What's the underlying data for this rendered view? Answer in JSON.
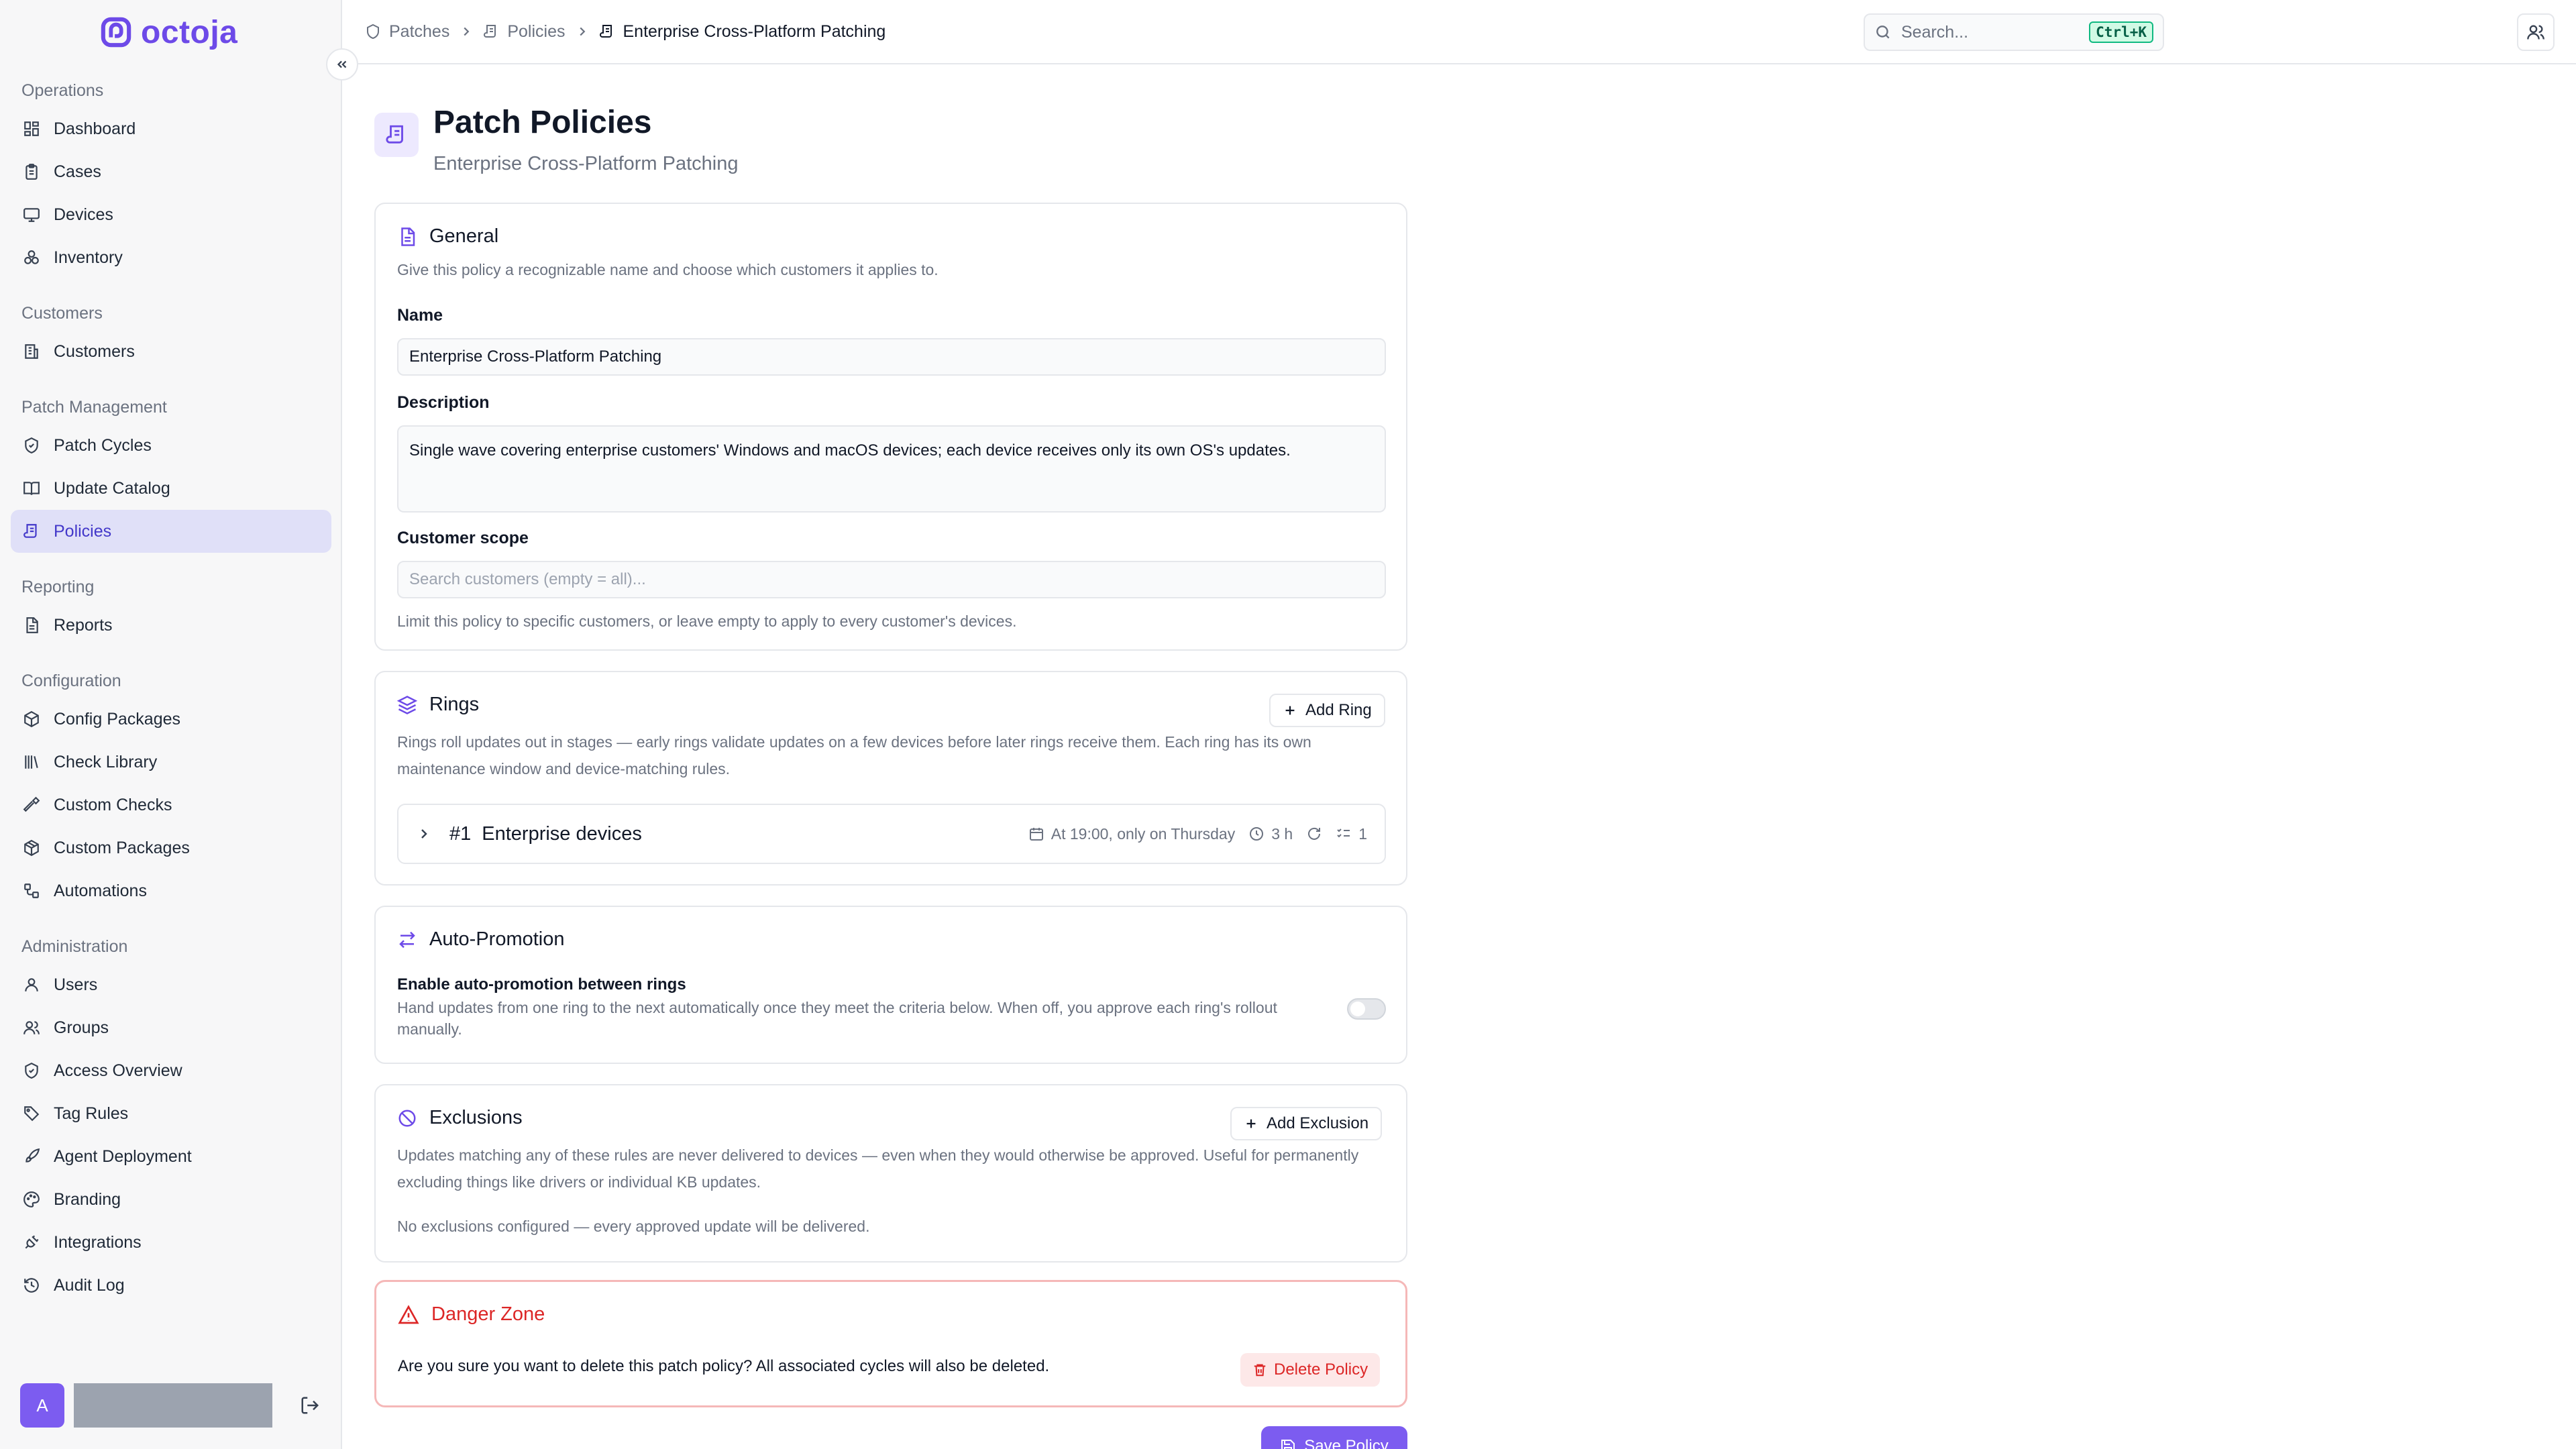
{
  "app": {
    "brand": "octoja"
  },
  "sidebar": {
    "sections": [
      {
        "title": "Operations",
        "items": [
          {
            "label": "Dashboard",
            "icon": "dashboard-icon"
          },
          {
            "label": "Cases",
            "icon": "clipboard-icon"
          },
          {
            "label": "Devices",
            "icon": "monitor-icon"
          },
          {
            "label": "Inventory",
            "icon": "boxes-icon"
          }
        ]
      },
      {
        "title": "Customers",
        "items": [
          {
            "label": "Customers",
            "icon": "building-icon"
          }
        ]
      },
      {
        "title": "Patch Management",
        "items": [
          {
            "label": "Patch Cycles",
            "icon": "shield-icon"
          },
          {
            "label": "Update Catalog",
            "icon": "book-icon"
          },
          {
            "label": "Policies",
            "icon": "scroll-icon",
            "active": true
          }
        ]
      },
      {
        "title": "Reporting",
        "items": [
          {
            "label": "Reports",
            "icon": "file-icon"
          }
        ]
      },
      {
        "title": "Configuration",
        "items": [
          {
            "label": "Config Packages",
            "icon": "package-icon"
          },
          {
            "label": "Check Library",
            "icon": "library-icon"
          },
          {
            "label": "Custom Checks",
            "icon": "hammer-icon"
          },
          {
            "label": "Custom Packages",
            "icon": "packages-icon"
          },
          {
            "label": "Automations",
            "icon": "workflow-icon"
          }
        ]
      },
      {
        "title": "Administration",
        "items": [
          {
            "label": "Users",
            "icon": "user-icon"
          },
          {
            "label": "Groups",
            "icon": "users-icon"
          },
          {
            "label": "Access Overview",
            "icon": "shield-check-icon"
          },
          {
            "label": "Tag Rules",
            "icon": "tag-icon"
          },
          {
            "label": "Agent Deployment",
            "icon": "rocket-icon"
          },
          {
            "label": "Branding",
            "icon": "palette-icon"
          },
          {
            "label": "Integrations",
            "icon": "plug-icon"
          },
          {
            "label": "Audit Log",
            "icon": "history-icon"
          }
        ]
      }
    ],
    "user_initial": "A"
  },
  "topbar": {
    "breadcrumbs": [
      "Patches",
      "Policies",
      "Enterprise Cross-Platform Patching"
    ],
    "search_placeholder": "Search...",
    "search_shortcut": "Ctrl+K"
  },
  "page": {
    "title": "Patch Policies",
    "subtitle": "Enterprise Cross-Platform Patching"
  },
  "general": {
    "title": "General",
    "description": "Give this policy a recognizable name and choose which customers it applies to.",
    "name_label": "Name",
    "name_value": "Enterprise Cross-Platform Patching",
    "description_label": "Description",
    "description_value": "Single wave covering enterprise customers' Windows and macOS devices; each device receives only its own OS's updates.",
    "scope_label": "Customer scope",
    "scope_placeholder": "Search customers (empty = all)...",
    "scope_help": "Limit this policy to specific customers, or leave empty to apply to every customer's devices."
  },
  "rings": {
    "title": "Rings",
    "add_label": "Add Ring",
    "description": "Rings roll updates out in stages — early rings validate updates on a few devices before later rings receive them. Each ring has its own maintenance window and device-matching rules.",
    "items": [
      {
        "number": "#1",
        "name": "Enterprise devices",
        "schedule": "At 19:00, only on Thursday",
        "duration": "3 h",
        "rules": "1"
      }
    ]
  },
  "auto_promotion": {
    "title": "Auto-Promotion",
    "toggle_label": "Enable auto-promotion between rings",
    "toggle_help": "Hand updates from one ring to the next automatically once they meet the criteria below. When off, you approve each ring's rollout manually.",
    "enabled": false
  },
  "exclusions": {
    "title": "Exclusions",
    "add_label": "Add Exclusion",
    "description": "Updates matching any of these rules are never delivered to devices — even when they would otherwise be approved. Useful for permanently excluding things like drivers or individual KB updates.",
    "empty_text": "No exclusions configured — every approved update will be delivered."
  },
  "danger_zone": {
    "title": "Danger Zone",
    "warning": "Are you sure you want to delete this patch policy? All associated cycles will also be deleted.",
    "delete_label": "Delete Policy"
  },
  "actions": {
    "save_label": "Save Policy"
  },
  "colors": {
    "accent": "#7c5cf0",
    "danger": "#dc2626",
    "active_nav_bg": "#e0e0f8"
  }
}
